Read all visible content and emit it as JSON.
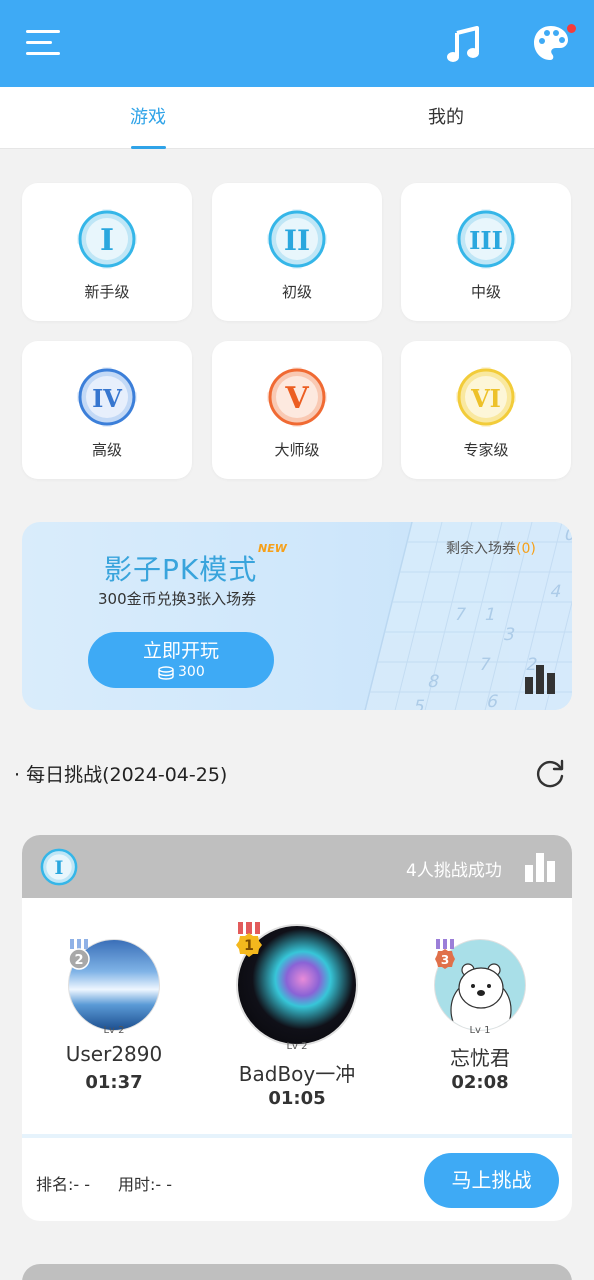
{
  "tabs": {
    "game": "游戏",
    "mine": "我的"
  },
  "levels": [
    {
      "numeral": "I",
      "label": "新手级"
    },
    {
      "numeral": "II",
      "label": "初级"
    },
    {
      "numeral": "III",
      "label": "中级"
    },
    {
      "numeral": "IV",
      "label": "高级"
    },
    {
      "numeral": "V",
      "label": "大师级"
    },
    {
      "numeral": "VI",
      "label": "专家级"
    }
  ],
  "banner": {
    "title": "影子PK模式",
    "new_tag": "NEW",
    "subtitle": "300金币兑换3张入场券",
    "remaining_label": "剩余入场券",
    "remaining_open": "(",
    "remaining_count": "0",
    "remaining_close": ")",
    "play_label": "立即开玩",
    "play_cost": "300"
  },
  "daily": {
    "title": "· 每日挑战(2024-04-25)",
    "level_numeral": "I",
    "success_text": "4人挑战成功",
    "players": [
      {
        "rank": "2",
        "level": "Lv 2",
        "name": "User2890",
        "time": "01:37"
      },
      {
        "rank": "1",
        "level": "Lv 2",
        "name": "BadBoy一冲",
        "time": "01:05"
      },
      {
        "rank": "3",
        "level": "Lv 1",
        "name": "忘忧君",
        "time": "02:08"
      }
    ],
    "rank_text": "排名:- -",
    "time_text": "用时:- -",
    "challenge_button": "马上挑战"
  },
  "colors": {
    "accent": "#3eaaf5",
    "badge_blue": "#35b6e8",
    "badge_orange": "#f06a33",
    "badge_yellow": "#f2cc3a",
    "new_tag": "#f6a019"
  },
  "icons": [
    "menu-icon",
    "music-note-icon",
    "palette-icon",
    "refresh-icon",
    "bar-chart-icon",
    "coin-stack-icon",
    "medal-icon"
  ]
}
